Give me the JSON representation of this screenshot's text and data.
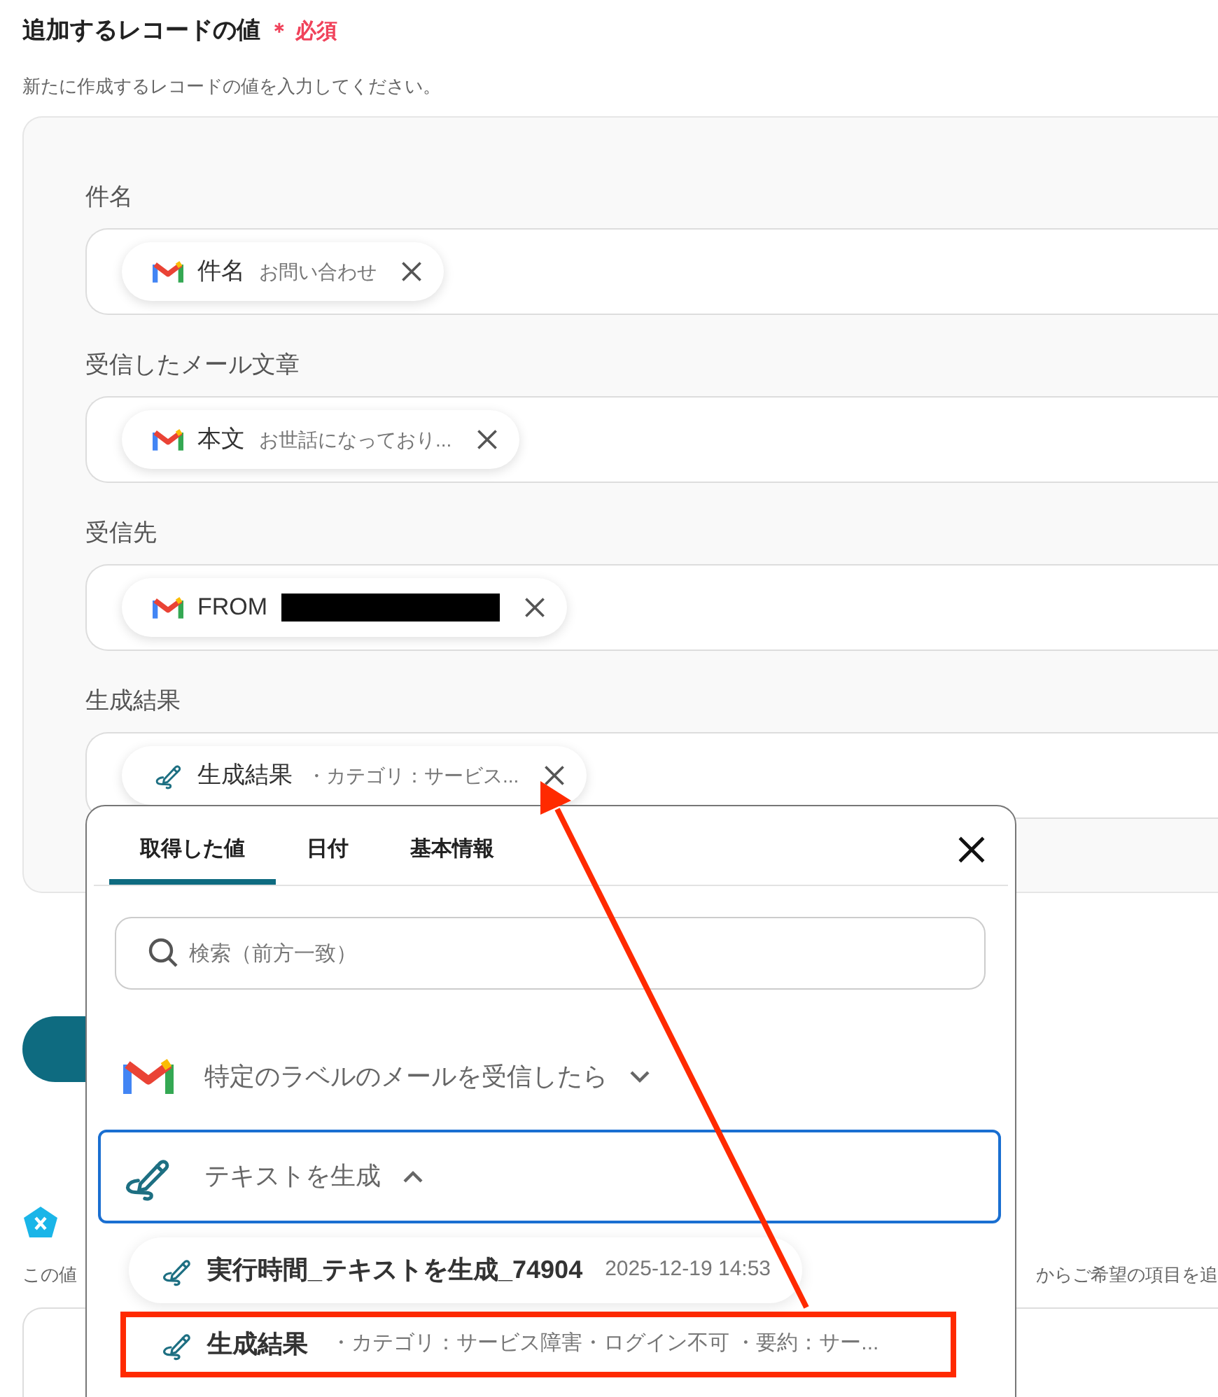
{
  "section": {
    "title": "追加するレコードの値",
    "required_label": "＊ 必須",
    "description": "新たに作成するレコードの値を入力してください。"
  },
  "fields": [
    {
      "label": "件名",
      "chip": {
        "kind": "gmail",
        "name": "件名",
        "value": "お問い合わせ",
        "redacted": false
      }
    },
    {
      "label": "受信したメール文章",
      "chip": {
        "kind": "gmail",
        "name": "本文",
        "value": "お世話になっており...",
        "redacted": false
      }
    },
    {
      "label": "受信先",
      "chip": {
        "kind": "gmail",
        "name": "FROM",
        "redacted": true
      }
    },
    {
      "label": "生成結果",
      "chip": {
        "kind": "pen",
        "name": "生成結果",
        "value": "・カテゴリ：サービス...",
        "redacted": false
      }
    }
  ],
  "lower_section": {
    "description_start": "この値",
    "description_end": "からご希望の項目を追"
  },
  "popup": {
    "tabs": [
      {
        "label": "取得した値",
        "selected": true
      },
      {
        "label": "日付",
        "selected": false
      },
      {
        "label": "基本情報",
        "selected": false
      }
    ],
    "search": {
      "placeholder": "検索（前方一致）"
    },
    "groups": [
      {
        "kind": "gmail",
        "title": "特定のラベルのメールを受信したら",
        "expanded": false
      },
      {
        "kind": "pen",
        "title": "テキストを生成",
        "expanded": true,
        "items": [
          {
            "name": "実行時間_テキストを生成_74904",
            "value": "2025-12-19 14:53",
            "highlighted": false
          },
          {
            "name": "生成結果",
            "value": "・カテゴリ：サービス障害・ログイン不可 ・要約：サー...",
            "highlighted": true
          }
        ]
      }
    ]
  }
}
